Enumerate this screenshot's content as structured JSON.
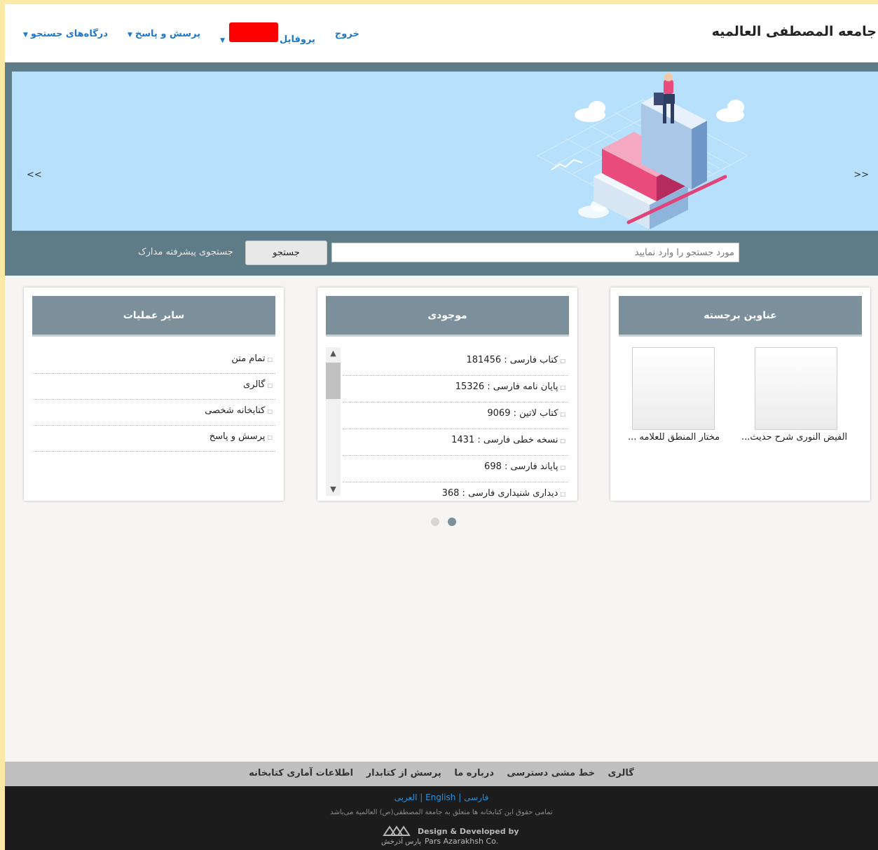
{
  "header": {
    "site_title": "جامعه المصطفی العالمیه",
    "nav": {
      "logout": "خروج",
      "profile": "پروفایل",
      "qa": "پرسش و پاسخ",
      "portals": "درگاه‌های جستجو"
    }
  },
  "slider": {
    "prev": "<<",
    "next": ">>"
  },
  "search": {
    "placeholder": "مورد جستجو را وارد نمایید",
    "button": "جستجو",
    "advanced": "جستجوی پیشرفته مدارک"
  },
  "featured": {
    "title": "عناوین برجسته",
    "items": [
      {
        "caption": "الفیض النوری شرح حدیث..."
      },
      {
        "caption": "مختار المنطق للعلامه ..."
      }
    ]
  },
  "inventory": {
    "title": "موجودی",
    "items": [
      {
        "label": "کتاب فارسی : 181456"
      },
      {
        "label": "پایان نامه فارسی : 15326"
      },
      {
        "label": "کتاب لاتین : 9069"
      },
      {
        "label": "نسخه خطی فارسی : 1431"
      },
      {
        "label": "پایاند فارسی : 698"
      },
      {
        "label": "دیداری شنیداری فارسی : 368"
      }
    ]
  },
  "operations": {
    "title": "سایر عملیات",
    "items": [
      {
        "label": "تمام متن"
      },
      {
        "label": "گالری"
      },
      {
        "label": "کتابخانه شخصی"
      },
      {
        "label": "پرسش و پاسخ"
      }
    ]
  },
  "footer": {
    "links": [
      "گالری",
      "خط مشی دسترسی",
      "درباره ما",
      "پرسش از کتابدار",
      "اطلاعات آماری کتابخانه"
    ],
    "lang_fa": "فارسی",
    "lang_en": "English",
    "lang_ar": "العربی",
    "copyright": "تمامی حقوق این کتابخانه ها متعلق به جامعة المصطفی(ص) العالمیة می‌باشد",
    "dev_line1": "Design & Developed by",
    "dev_line2": "Pars Azarakhsh Co.",
    "dev_logo_text": "پارس آذرخش"
  },
  "colors": {
    "nav_link": "#1f78c8",
    "card_header": "#7b909a",
    "hero_bg": "#5e7b88",
    "slider_bg": "#b6e0fb"
  }
}
